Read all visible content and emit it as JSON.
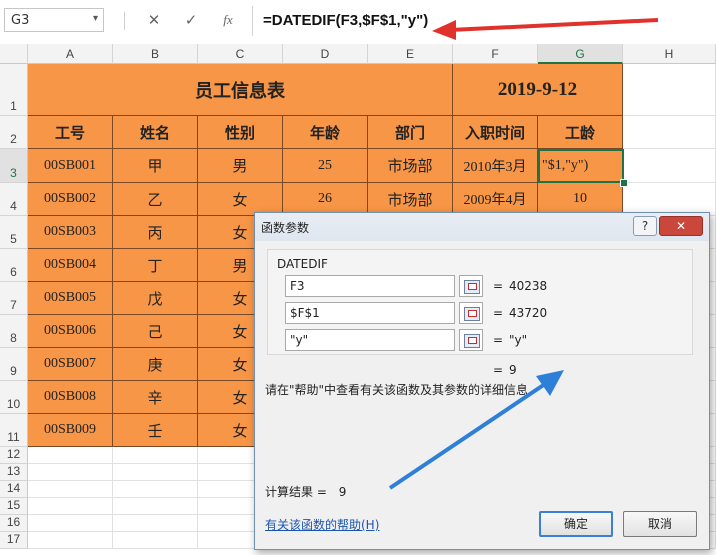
{
  "formula_bar": {
    "name_box": "G3",
    "name_arrow": "▾",
    "cancel_icon": "✕",
    "enter_icon": "✓",
    "fx_icon": "fx",
    "formula": "=DATEDIF(F3,$F$1,\"y\")"
  },
  "columns": [
    "A",
    "B",
    "C",
    "D",
    "E",
    "F",
    "G",
    "H"
  ],
  "rows": [
    "1",
    "2",
    "3",
    "4",
    "5",
    "6",
    "7",
    "8",
    "9",
    "10",
    "11",
    "12",
    "13",
    "14",
    "15",
    "16",
    "17"
  ],
  "sheet": {
    "title": "员工信息表",
    "date": "2019-9-12",
    "headers": [
      "工号",
      "姓名",
      "性别",
      "年龄",
      "部门",
      "入职时间",
      "工龄"
    ],
    "records": [
      {
        "id": "00SB001",
        "name": "甲",
        "gender": "男",
        "age": "25",
        "dept": "市场部",
        "hire": "2010年3月",
        "tenure": "\"$1,\"y\")"
      },
      {
        "id": "00SB002",
        "name": "乙",
        "gender": "女",
        "age": "26",
        "dept": "市场部",
        "hire": "2009年4月",
        "tenure": "10"
      },
      {
        "id": "00SB003",
        "name": "丙",
        "gender": "女",
        "age": "",
        "dept": "",
        "hire": "",
        "tenure": ""
      },
      {
        "id": "00SB004",
        "name": "丁",
        "gender": "男",
        "age": "",
        "dept": "",
        "hire": "",
        "tenure": ""
      },
      {
        "id": "00SB005",
        "name": "戊",
        "gender": "女",
        "age": "",
        "dept": "",
        "hire": "",
        "tenure": ""
      },
      {
        "id": "00SB006",
        "name": "己",
        "gender": "女",
        "age": "",
        "dept": "",
        "hire": "",
        "tenure": ""
      },
      {
        "id": "00SB007",
        "name": "庚",
        "gender": "女",
        "age": "",
        "dept": "",
        "hire": "",
        "tenure": ""
      },
      {
        "id": "00SB008",
        "name": "辛",
        "gender": "女",
        "age": "",
        "dept": "",
        "hire": "",
        "tenure": ""
      },
      {
        "id": "00SB009",
        "name": "壬",
        "gender": "女",
        "age": "",
        "dept": "",
        "hire": "",
        "tenure": ""
      }
    ]
  },
  "dialog": {
    "title": "函数参数",
    "help_glyph": "?",
    "close_glyph": "✕",
    "function_name": "DATEDIF",
    "args": [
      {
        "value": "F3",
        "result": "40238"
      },
      {
        "value": "$F$1",
        "result": "43720"
      },
      {
        "value": "\"y\"",
        "result": "\"y\""
      }
    ],
    "equals": "=",
    "formula_result": "9",
    "description": "请在\"帮助\"中查看有关该函数及其参数的详细信息",
    "result_label": "计算结果 =",
    "result_value": "9",
    "help_link": "有关该函数的帮助(H)",
    "ok_label": "确定",
    "cancel_label": "取消"
  },
  "colors": {
    "cell_fill": "#f79646",
    "annotation_arrow": "#e0312a",
    "annotation_arrow2": "#2e7fd8"
  }
}
